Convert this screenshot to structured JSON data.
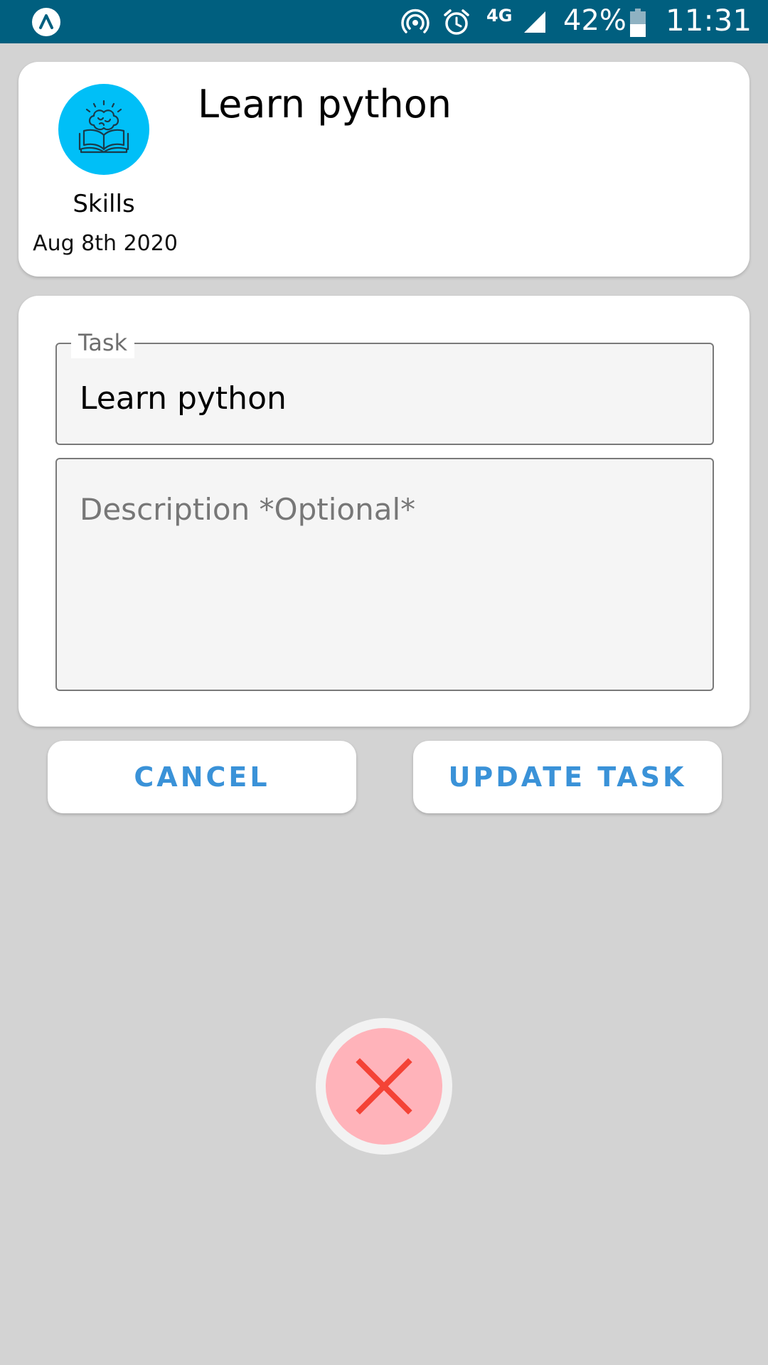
{
  "status_bar": {
    "network_type": "4G",
    "battery_percent": "42%",
    "time": "11:31"
  },
  "header": {
    "category": "Skills",
    "date": "Aug 8th 2020",
    "title": "Learn python",
    "category_icon": "brain-book-icon",
    "category_color": "#00bff7"
  },
  "form": {
    "task_label": "Task",
    "task_value": "Learn python",
    "description_placeholder": "Description *Optional*",
    "description_value": ""
  },
  "actions": {
    "cancel_label": "CANCEL",
    "update_label": "UPDATE TASK",
    "accent_color": "#3a92d8"
  },
  "close_button": {
    "icon": "close-icon",
    "color": "#f44336"
  }
}
